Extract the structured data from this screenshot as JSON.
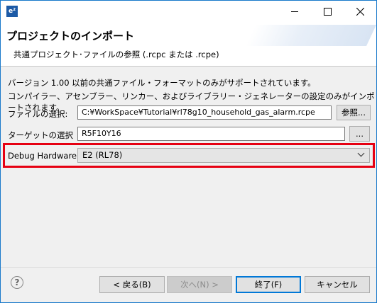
{
  "window": {
    "icon_text": "e²"
  },
  "banner": {
    "title": "プロジェクトのインポート",
    "subtitle": "共通プロジェクト･ファイルの参照 (.rcpc または .rcpe)"
  },
  "description": {
    "line1": "バージョン 1.00 以前の共通ファイル・フォーマットのみがサポートされています。",
    "line2": "コンパイラー、アセンブラー、リンカー、およびライブラリー・ジェネレーターの設定のみがインポートされます。"
  },
  "form": {
    "file_label": "ファイルの選択:",
    "file_value": "C:¥WorkSpace¥Tutorial¥rl78g10_household_gas_alarm.rcpe",
    "browse_label": "参照...",
    "target_label": "ターゲットの選択",
    "target_value": "R5F10Y16",
    "target_browse_label": "...",
    "debug_label": "Debug Hardware",
    "debug_value": "E2 (RL78)"
  },
  "buttons": {
    "help": "?",
    "back": "< 戻る(B)",
    "next": "次へ(N) >",
    "finish": "終了(F)",
    "cancel": "キャンセル"
  },
  "colors": {
    "highlight": "#e60012",
    "window_border": "#1979ca",
    "default_button": "#0078d7"
  }
}
